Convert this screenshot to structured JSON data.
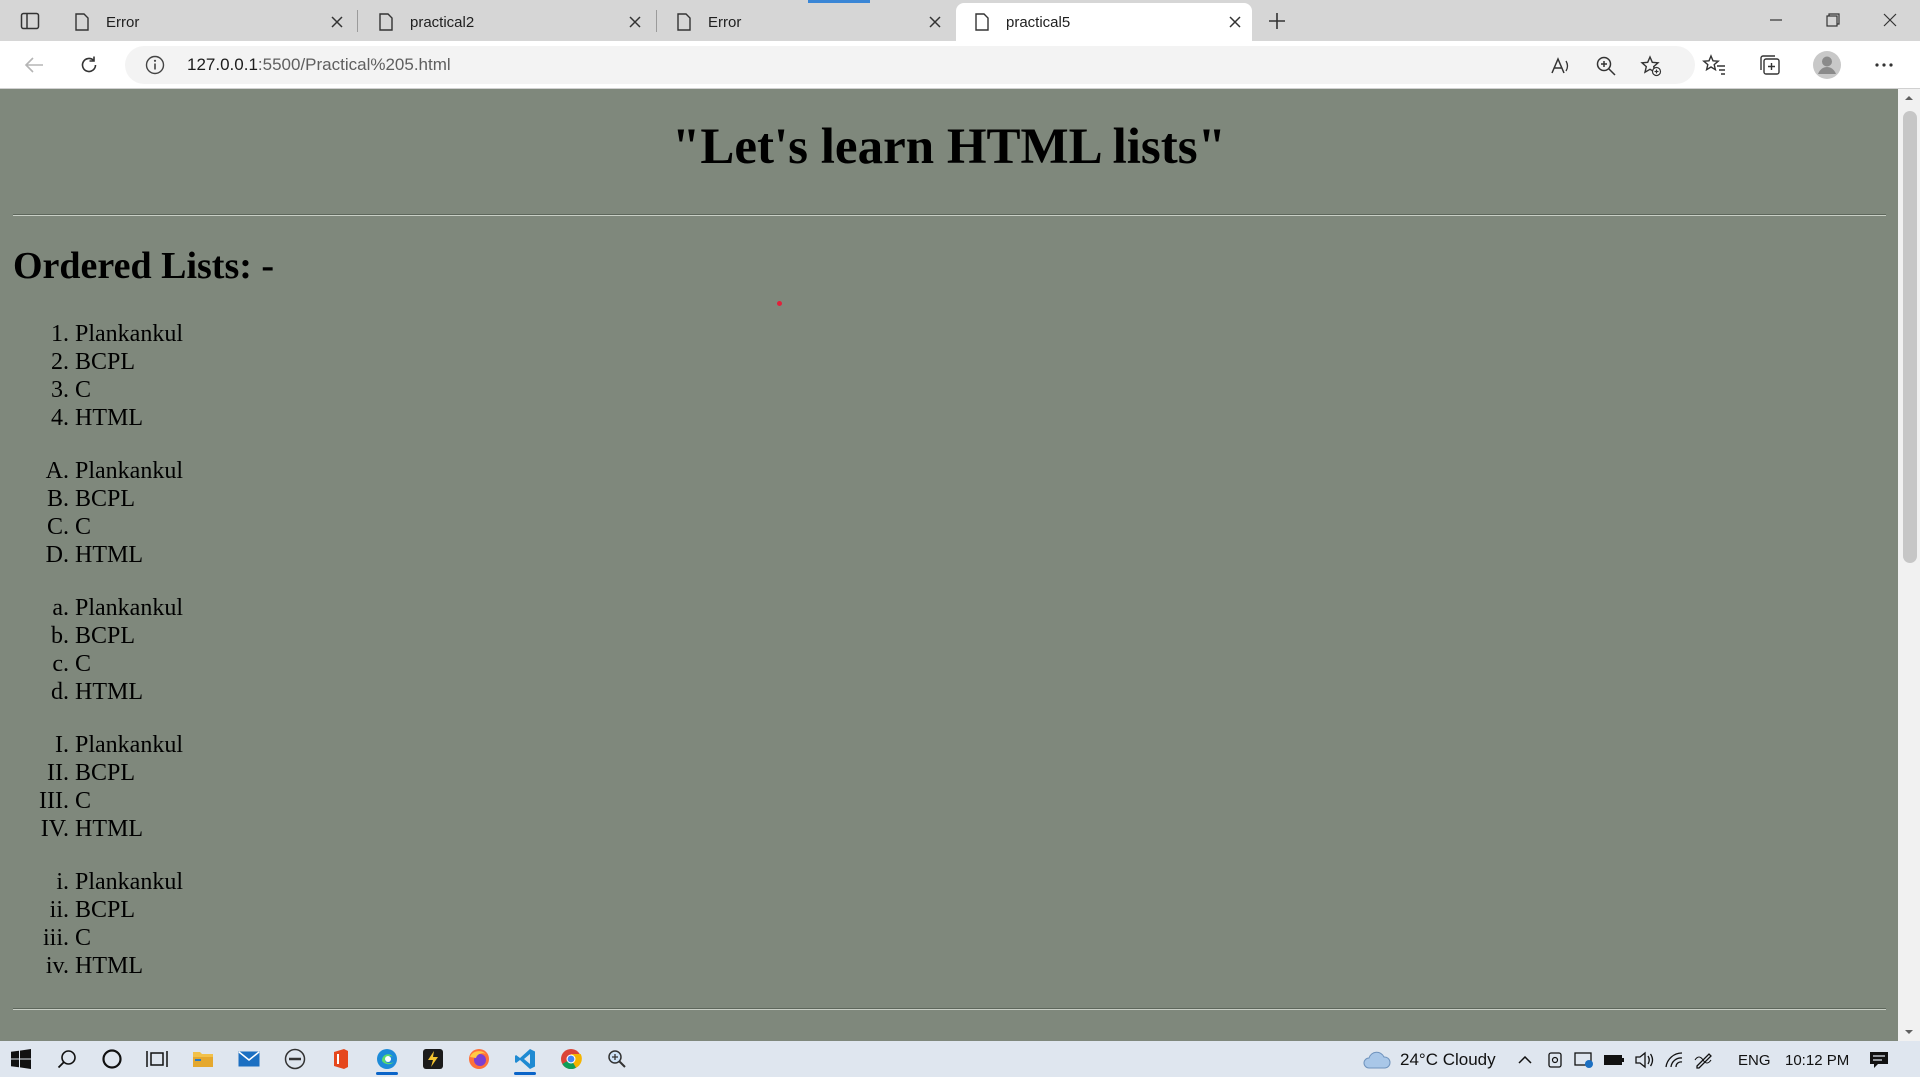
{
  "browser": {
    "tabs": [
      {
        "title": "Error",
        "active": false
      },
      {
        "title": "practical2",
        "active": false
      },
      {
        "title": "Error",
        "active": false
      },
      {
        "title": "practical5",
        "active": true
      }
    ],
    "url_host": "127.0.0.1",
    "url_rest": ":5500/Practical%205.html"
  },
  "page": {
    "title": "\"Let's learn HTML lists\"",
    "heading": "Ordered Lists: -",
    "lists": [
      {
        "markers": [
          "1.",
          "2.",
          "3.",
          "4."
        ],
        "items": [
          "Plankankul",
          "BCPL",
          "C",
          "HTML"
        ]
      },
      {
        "markers": [
          "A.",
          "B.",
          "C.",
          "D."
        ],
        "items": [
          "Plankankul",
          "BCPL",
          "C",
          "HTML"
        ]
      },
      {
        "markers": [
          "a.",
          "b.",
          "c.",
          "d."
        ],
        "items": [
          "Plankankul",
          "BCPL",
          "C",
          "HTML"
        ]
      },
      {
        "markers": [
          "I.",
          "II.",
          "III.",
          "IV."
        ],
        "items": [
          "Plankankul",
          "BCPL",
          "C",
          "HTML"
        ]
      },
      {
        "markers": [
          "i.",
          "ii.",
          "iii.",
          "iv."
        ],
        "items": [
          "Plankankul",
          "BCPL",
          "C",
          "HTML"
        ]
      }
    ]
  },
  "taskbar": {
    "weather": "24°C  Cloudy",
    "language": "ENG",
    "time": "10:12 PM"
  },
  "colors": {
    "page_background": "#7f887c",
    "accent": "#0a64c8"
  }
}
